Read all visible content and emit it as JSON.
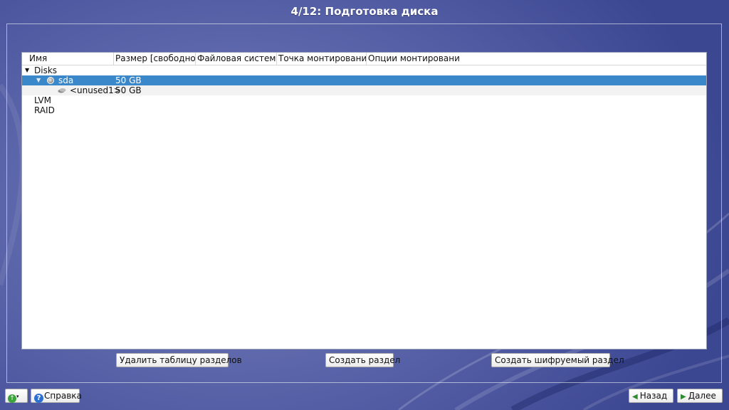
{
  "header": {
    "title": "4/12: Подготовка диска"
  },
  "tree": {
    "columns": [
      "Имя",
      "Размер [свободно]",
      "Файловая система",
      "Точка монтирования",
      "Опции монтирования"
    ],
    "rows": [
      {
        "name": "Disks",
        "size": "",
        "level": 0,
        "expanded": true
      },
      {
        "name": "sda",
        "size": "50 GB",
        "level": 1,
        "expanded": true,
        "selected": true,
        "icon": "disk-icon"
      },
      {
        "name": "<unused1>",
        "size": "50 GB",
        "level": 2,
        "icon": "partition-icon"
      },
      {
        "name": "LVM",
        "size": "",
        "level": 0
      },
      {
        "name": "RAID",
        "size": "",
        "level": 0
      }
    ]
  },
  "actions": {
    "delete_table": "Удалить таблицу разделов",
    "create_partition": "Создать раздел",
    "create_encrypted": "Создать шифруемый раздел"
  },
  "footer": {
    "help": "Справка",
    "back": "Назад",
    "next": "Далее"
  },
  "colors": {
    "selection": "#3a87c9",
    "background": "#4a559e"
  }
}
